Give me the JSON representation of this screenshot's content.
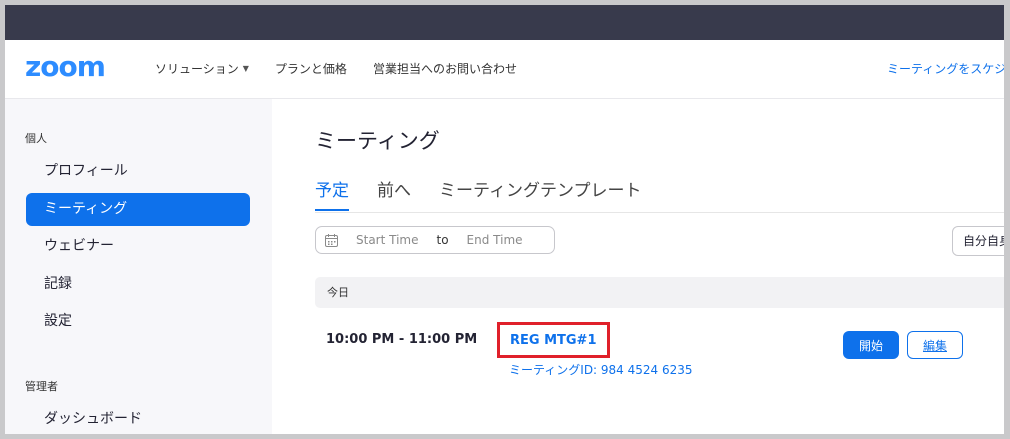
{
  "header": {
    "logo": "zoom",
    "nav": [
      {
        "label": "ソリューション",
        "has_dropdown": true
      },
      {
        "label": "プランと価格"
      },
      {
        "label": "営業担当へのお問い合わせ"
      }
    ],
    "schedule_link": "ミーティングをスケジュ"
  },
  "sidebar": {
    "personal_label": "個人",
    "items": [
      {
        "label": "プロフィール"
      },
      {
        "label": "ミーティング",
        "active": true
      },
      {
        "label": "ウェビナー"
      },
      {
        "label": "記録"
      },
      {
        "label": "設定"
      }
    ],
    "admin_label": "管理者",
    "admin_items": [
      {
        "label": "ダッシュボード"
      }
    ]
  },
  "main": {
    "title": "ミーティング",
    "tabs": [
      {
        "label": "予定",
        "active": true
      },
      {
        "label": "前へ"
      },
      {
        "label": "ミーティングテンプレート"
      }
    ],
    "date_range": {
      "start_placeholder": "Start Time",
      "to_label": "to",
      "end_placeholder": "End Time"
    },
    "timezone_button": "自分自身",
    "date_header": "今日",
    "meeting": {
      "time": "10:00 PM - 11:00 PM",
      "topic": "REG MTG#1",
      "meeting_id": "ミーティングID: 984 4524 6235",
      "start_label": "開始",
      "edit_label": "編集"
    }
  },
  "colors": {
    "accent": "#0e71eb",
    "logo": "#2d8cff",
    "topbar": "#383a4c",
    "highlight_border": "#e0202a"
  },
  "icons": {
    "calendar": "calendar-icon",
    "dropdown": "chevron-down-icon"
  }
}
